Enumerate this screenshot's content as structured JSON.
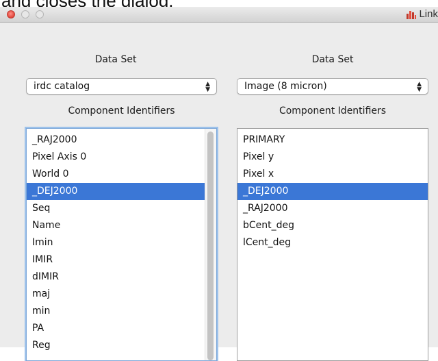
{
  "caption": {
    "text": "and closes the dialog."
  },
  "window": {
    "title": "Link",
    "title_icon": "bar-chart-icon"
  },
  "left": {
    "dataset_label": "Data Set",
    "dataset_value": "irdc catalog",
    "components_label": "Component Identifiers",
    "items": [
      "_RAJ2000",
      "Pixel Axis 0",
      "World 0",
      "_DEJ2000",
      "Seq",
      "Name",
      "Imin",
      "IMIR",
      "dIMIR",
      "maj",
      "min",
      "PA",
      "Reg"
    ],
    "selected_item": "_DEJ2000"
  },
  "right": {
    "dataset_label": "Data Set",
    "dataset_value": "Image (8 micron)",
    "components_label": "Component Identifiers",
    "items": [
      "PRIMARY",
      "Pixel y",
      "Pixel x",
      "_DEJ2000",
      "_RAJ2000",
      "bCent_deg",
      "lCent_deg"
    ],
    "selected_item": "_DEJ2000"
  },
  "colors": {
    "selection": "#3b77d6",
    "close_button": "#e0443a"
  }
}
